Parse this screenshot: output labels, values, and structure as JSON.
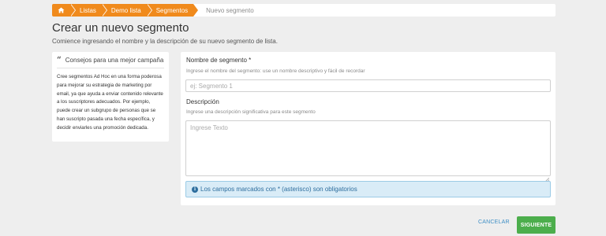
{
  "breadcrumb": {
    "home_icon": "home-icon",
    "items": [
      "Listas",
      "Demo lista",
      "Segmentos"
    ],
    "current": "Nuevo segmento"
  },
  "header": {
    "title": "Crear un nuevo segmento",
    "subtitle": "Comience ingresando el nombre y la descripción de su nuevo segmento de lista."
  },
  "tips": {
    "title": "Consejos para una mejor campaña",
    "icon": "quote-icon",
    "body": "Cree segmentos Ad Hoc en una forma poderosa para mejorar su estrategia de marketing por email, ya que ayuda a enviar contenido relevante a los suscriptores adecuados. Por ejemplo, puede crear un subgrupo de personas que se han suscripto pasada una fecha específica, y decidir enviarles una promoción dedicada."
  },
  "form": {
    "name_label": "Nombre de segmento *",
    "name_hint": "Ingrese el nombre del segmento: use un nombre descriptivo y fácil de recordar",
    "name_placeholder": "ej: Segmento 1",
    "name_value": "",
    "desc_label": "Descripción",
    "desc_hint": "Ingrese una descripción significativa para este segmento",
    "desc_placeholder": "Ingrese Texto",
    "desc_value": "",
    "required_notice": "Los campos marcados con * (asterisco) son obligatorios"
  },
  "actions": {
    "cancel_label": "CANCELAR",
    "next_label": "SIGUIENTE"
  },
  "colors": {
    "accent": "#f08a1c",
    "success": "#4cae4c",
    "info_bg": "#d9ecf7",
    "link": "#3f8fc5"
  }
}
